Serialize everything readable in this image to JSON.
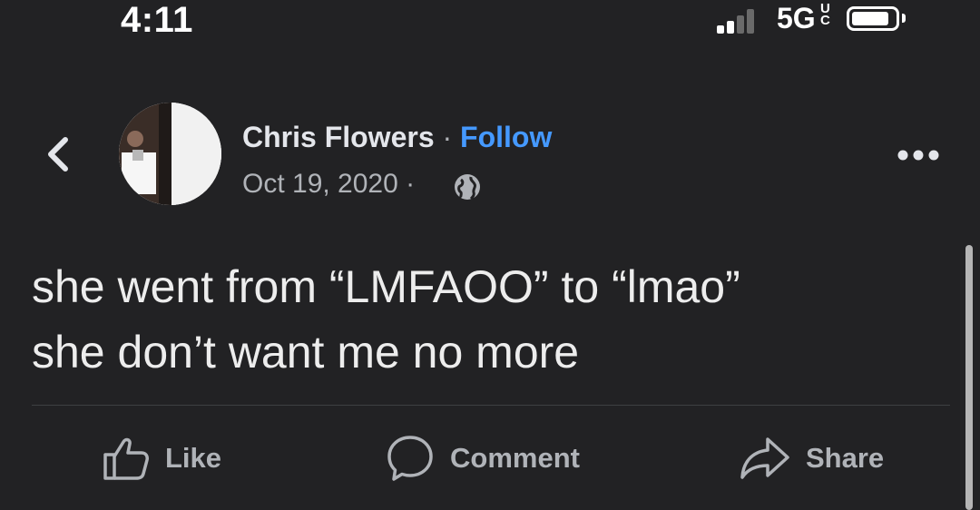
{
  "status_bar": {
    "time": "4:11",
    "network": "5G",
    "network_suffix": "UC"
  },
  "post": {
    "author": "Chris Flowers",
    "separator": "·",
    "follow_label": "Follow",
    "date": "Oct 19, 2020",
    "meta_separator": "·",
    "privacy_icon": "globe-icon",
    "text_lines": [
      "she went from “LMFAOO” to “lmao”",
      "she don’t want me no more"
    ]
  },
  "actions": {
    "like_label": "Like",
    "comment_label": "Comment",
    "share_label": "Share"
  },
  "colors": {
    "background": "#222224",
    "follow": "#4599ff",
    "muted_text": "#b0b3b8"
  }
}
